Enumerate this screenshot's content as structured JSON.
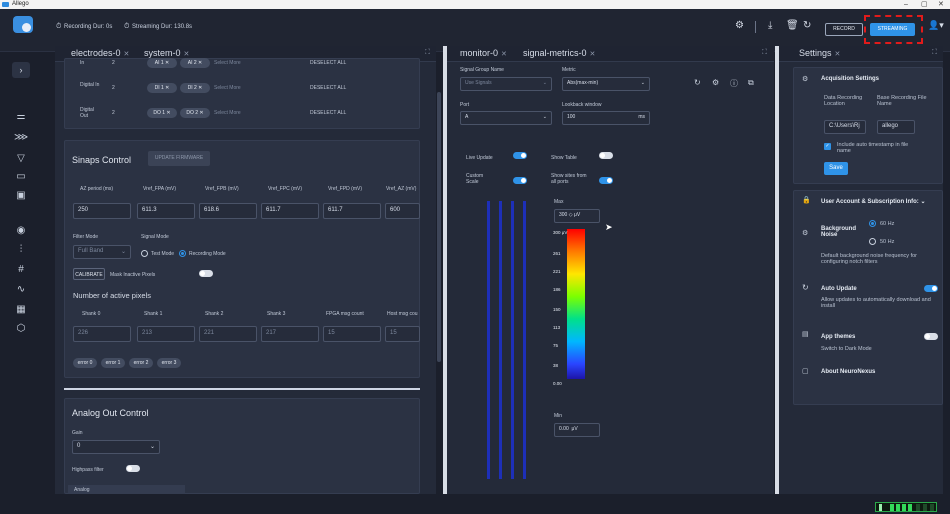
{
  "titlebar": {
    "title": "Allego",
    "minimize": "–",
    "maximize": "▢",
    "close": "✕"
  },
  "topbar": {
    "recording_dur": "Recording Dur: 0s",
    "streaming_dur": "Streaming Dur: 130.8s",
    "record_label": "RECORD",
    "streaming_label": "STREAMING"
  },
  "left_panel": {
    "tabs": [
      "electrodes-0",
      "system-0"
    ],
    "rows": [
      {
        "name": "In",
        "count": "2",
        "chips": [
          "AI 1",
          "AI 2"
        ],
        "select": "Select More",
        "deselect": "DESELECT ALL"
      },
      {
        "name": "Digital In",
        "count": "2",
        "chips": [
          "DI 1",
          "DI 2"
        ],
        "select": "Select More",
        "deselect": "DESELECT ALL"
      },
      {
        "name": "Digital Out",
        "count": "2",
        "chips": [
          "DO 1",
          "DO 2"
        ],
        "select": "Select More",
        "deselect": "DESELECT ALL"
      }
    ],
    "sinaps": {
      "title": "Sinaps Control",
      "update_firmware": "UPDATE FIRMWARE",
      "vref_labels": [
        "AZ period (ms)",
        "Vref_FPA (mV)",
        "Vref_FPB (mV)",
        "Vref_FPC (mV)",
        "Vref_FPD (mV)",
        "Vref_AZ (mV)"
      ],
      "vref_values": [
        "250",
        "611.3",
        "618.6",
        "611.7",
        "611.7",
        "600"
      ],
      "filter_mode_label": "Filter Mode",
      "filter_mode_value": "Full Band",
      "signal_mode_label": "Signal Mode",
      "test_mode": "Test Mode",
      "recording_mode": "Recording Mode",
      "calibrate": "CALIBRATE",
      "mask_inactive": "Mask Inactive Pixels",
      "active_pixels_title": "Number of active pixels",
      "shank_labels": [
        "Shank 0",
        "Shank 1",
        "Shank 2",
        "Shank 3",
        "FPGA msg count",
        "Host msg cou"
      ],
      "shank_values": [
        "226",
        "213",
        "221",
        "217",
        "15",
        "15"
      ],
      "error_chips": [
        "error 0",
        "error 1",
        "error 2",
        "error 3"
      ]
    },
    "analog_out": {
      "title": "Analog Out Control",
      "gain_label": "Gain",
      "gain_value": "0",
      "highpass_label": "Highpass filter",
      "analog_label": "Analog"
    }
  },
  "middle_panel": {
    "tabs": [
      "monitor-0",
      "signal-metrics-0"
    ],
    "signal_group_label": "Signal Group Name",
    "signal_group_value": "Use Signals",
    "metric_label": "Metric",
    "metric_value": "Abs(max-min)",
    "port_label": "Port",
    "port_value": "A",
    "lookback_label": "Lookback window",
    "lookback_value": "100",
    "lookback_unit": "ms",
    "live_update": "Live Update",
    "show_table": "Show Table",
    "custom_scale": "Custom Scale",
    "show_sites": "Show sites from all ports",
    "max_label": "Max",
    "max_value": "300",
    "max_unit": "μV",
    "min_label": "Min",
    "min_value": "0.00",
    "min_unit": "μV",
    "scale_ticks": [
      "300 μV",
      "261",
      "221",
      "186",
      "150",
      "113",
      "75",
      "38",
      "0.00"
    ]
  },
  "settings_panel": {
    "tab": "Settings",
    "acquisition_title": "Acquisition Settings",
    "data_recording_label": "Data Recording Location",
    "base_file_label": "Base Recording File Name",
    "location_value": "C:\\Users\\Rj",
    "base_file_value": "allego",
    "timestamp_label": "Include auto timestamp in file name",
    "save_label": "Save",
    "user_account": "User Account & Subscription Info:",
    "background_noise": "Background Noise",
    "hz60": "60 Hz",
    "hz50": "50 Hz",
    "noise_desc": "Default background noise frequency for configuring notch filters",
    "auto_update": "Auto Update",
    "auto_update_desc": "Allow updates to automatically download and install",
    "app_themes": "App themes",
    "app_themes_desc": "Switch to Dark Mode",
    "about": "About NeuroNexus"
  }
}
